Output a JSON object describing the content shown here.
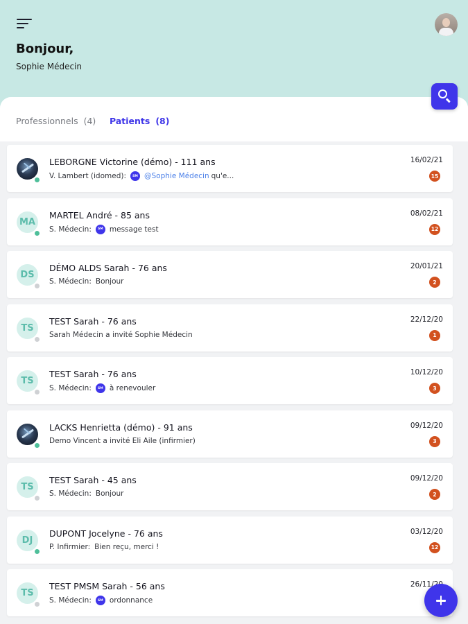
{
  "header": {
    "greeting": "Bonjour,",
    "user_name": "Sophie Médecin",
    "background_color": "#c7e8e4"
  },
  "tabs": {
    "professionals": {
      "label": "Professionnels",
      "count": "(4)"
    },
    "patients": {
      "label": "Patients",
      "count": "(8)",
      "active": true
    }
  },
  "accent_color": "#3f35ea",
  "badge_color": "#d2511f",
  "conversations": [
    {
      "initials": "",
      "photo": true,
      "online": true,
      "name": "LEBORGNE Victorine (démo) - 111 ans",
      "author": "V. Lambert (idomed):",
      "mini_avatar": true,
      "mention": "@Sophie Médecin",
      "message": "qu'e...",
      "date": "16/02/21",
      "unread": "15"
    },
    {
      "initials": "MA",
      "photo": false,
      "online": true,
      "name": "MARTEL André - 85 ans",
      "author": "S. Médecin:",
      "mini_avatar": true,
      "mention": "",
      "message": "message test",
      "date": "08/02/21",
      "unread": "12"
    },
    {
      "initials": "DS",
      "photo": false,
      "online": false,
      "name": "DÉMO ALDS Sarah - 76 ans",
      "author": "S. Médecin:",
      "mini_avatar": false,
      "mention": "",
      "message": "Bonjour",
      "date": "20/01/21",
      "unread": "2"
    },
    {
      "initials": "TS",
      "photo": false,
      "online": false,
      "name": "TEST Sarah - 76 ans",
      "author": "",
      "mini_avatar": false,
      "mention": "",
      "message": "Sarah Médecin a invité Sophie Médecin",
      "date": "22/12/20",
      "unread": "1"
    },
    {
      "initials": "TS",
      "photo": false,
      "online": false,
      "name": "TEST Sarah - 76 ans",
      "author": "S. Médecin:",
      "mini_avatar": true,
      "mention": "",
      "message": "à renevouler",
      "date": "10/12/20",
      "unread": "3"
    },
    {
      "initials": "",
      "photo": true,
      "online": true,
      "name": "LACKS Henrietta (démo) - 91 ans",
      "author": "",
      "mini_avatar": false,
      "mention": "",
      "message": "Demo Vincent a invité Eli Aile (infirmier)",
      "date": "09/12/20",
      "unread": "3"
    },
    {
      "initials": "TS",
      "photo": false,
      "online": false,
      "name": "TEST Sarah - 45 ans",
      "author": "S. Médecin:",
      "mini_avatar": false,
      "mention": "",
      "message": "Bonjour",
      "date": "09/12/20",
      "unread": "2"
    },
    {
      "initials": "DJ",
      "photo": false,
      "online": true,
      "name": "DUPONT Jocelyne  - 76 ans",
      "author": "P. Infirmier:",
      "mini_avatar": false,
      "mention": "",
      "message": "Bien reçu, merci !",
      "date": "03/12/20",
      "unread": "12"
    },
    {
      "initials": "TS",
      "photo": false,
      "online": false,
      "name": "TEST PMSM Sarah - 56 ans",
      "author": "S. Médecin:",
      "mini_avatar": true,
      "mention": "",
      "message": "ordonnance",
      "date": "26/11/20",
      "unread": ""
    }
  ]
}
